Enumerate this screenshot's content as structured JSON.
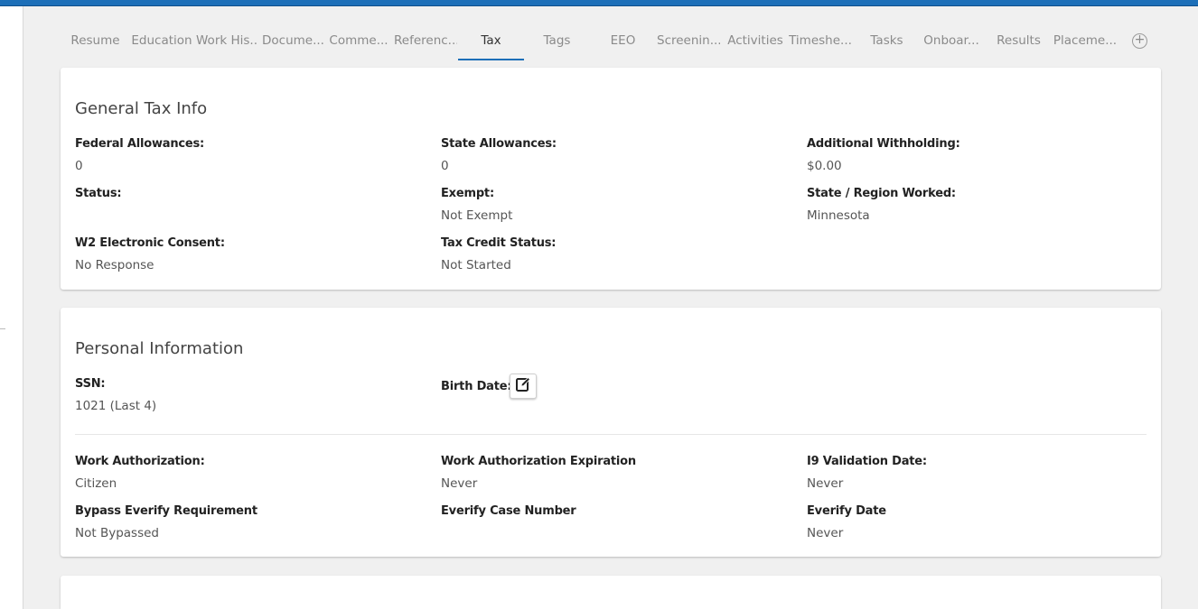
{
  "tabs": [
    {
      "label": "Resume",
      "active": false
    },
    {
      "label": "Education",
      "active": false
    },
    {
      "label": "Work His...",
      "active": false
    },
    {
      "label": "Docume...",
      "active": false
    },
    {
      "label": "Comme...",
      "active": false
    },
    {
      "label": "Referenc...",
      "active": false
    },
    {
      "label": "Tax",
      "active": true
    },
    {
      "label": "Tags",
      "active": false
    },
    {
      "label": "EEO",
      "active": false
    },
    {
      "label": "Screenin...",
      "active": false
    },
    {
      "label": "Activities",
      "active": false
    },
    {
      "label": "Timeshe...",
      "active": false
    },
    {
      "label": "Tasks",
      "active": false
    },
    {
      "label": "Onboar...",
      "active": false
    },
    {
      "label": "Results",
      "active": false
    },
    {
      "label": "Placeme...",
      "active": false
    }
  ],
  "add_tab_icon": "plus-circle-icon",
  "general_tax": {
    "title": "General Tax Info",
    "federal_allowances": {
      "label": "Federal Allowances:",
      "value": "0"
    },
    "state_allowances": {
      "label": "State Allowances:",
      "value": "0"
    },
    "additional_withholding": {
      "label": "Additional Withholding:",
      "value": "$0.00"
    },
    "status": {
      "label": "Status:",
      "value": ""
    },
    "exempt": {
      "label": "Exempt:",
      "value": "Not Exempt"
    },
    "state_region": {
      "label": "State / Region Worked:",
      "value": "Minnesota"
    },
    "w2_consent": {
      "label": "W2 Electronic Consent:",
      "value": "No Response"
    },
    "tax_credit": {
      "label": "Tax Credit Status:",
      "value": "Not Started"
    }
  },
  "personal": {
    "title": "Personal Information",
    "ssn": {
      "label": "SSN:",
      "value": "1021 (Last 4)"
    },
    "birth_date": {
      "label": "Birth Date:",
      "edit_icon": "edit-icon"
    },
    "work_auth": {
      "label": "Work Authorization:",
      "value": "Citizen"
    },
    "work_auth_exp": {
      "label": "Work Authorization Expiration",
      "value": "Never"
    },
    "i9_date": {
      "label": "I9 Validation Date:",
      "value": "Never"
    },
    "bypass_everify": {
      "label": "Bypass Everify Requirement",
      "value": "Not Bypassed"
    },
    "everify_case": {
      "label": "Everify Case Number",
      "value": ""
    },
    "everify_date": {
      "label": "Everify Date",
      "value": "Never"
    }
  },
  "colors": {
    "accent": "#1d6fb8",
    "background": "#f0f0f0"
  }
}
